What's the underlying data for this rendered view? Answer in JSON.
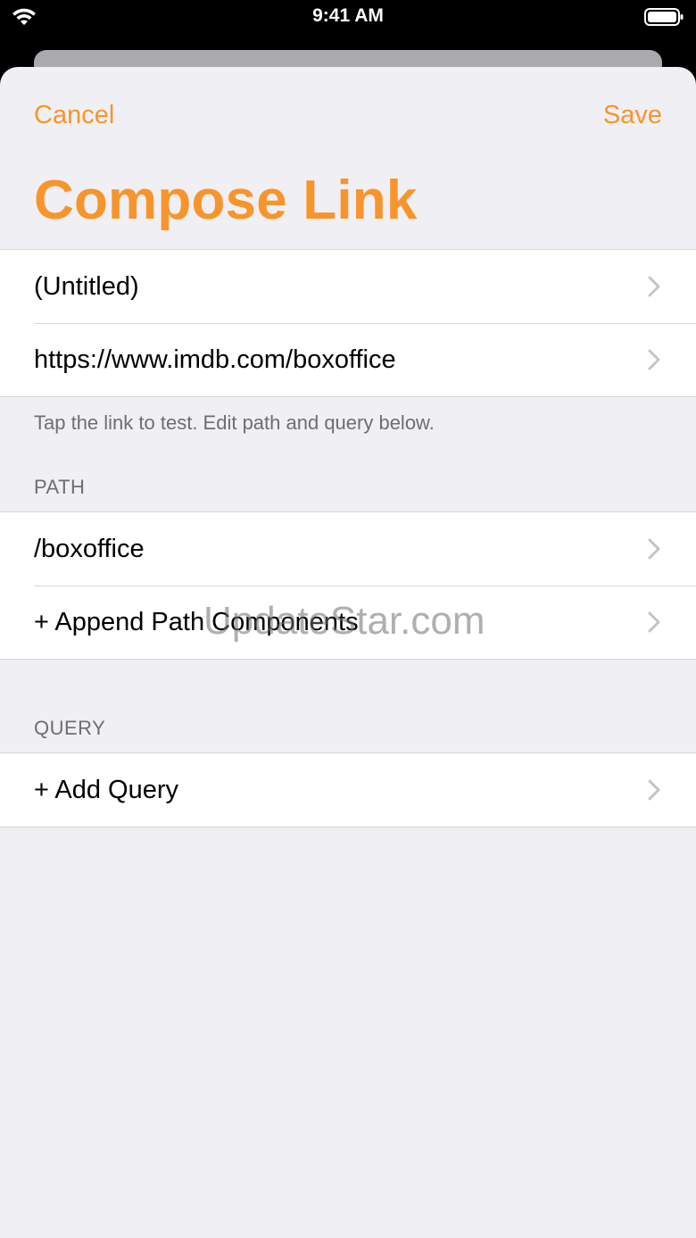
{
  "status_bar": {
    "time": "9:41 AM"
  },
  "nav": {
    "cancel_label": "Cancel",
    "save_label": "Save",
    "title": "Compose Link"
  },
  "link_group": {
    "title_row": "(Untitled)",
    "url_row": "https://www.imdb.com/boxoffice",
    "footer": "Tap the link to test. Edit path and query below."
  },
  "path_section": {
    "header": "PATH",
    "items": [
      "/boxoffice",
      "+ Append Path Components"
    ]
  },
  "query_section": {
    "header": "QUERY",
    "items": [
      "+ Add Query"
    ]
  },
  "watermark": "UpdateStar.com",
  "colors": {
    "accent": "#f7952c",
    "background": "#efeff4",
    "secondary_text": "#6d6d72"
  }
}
